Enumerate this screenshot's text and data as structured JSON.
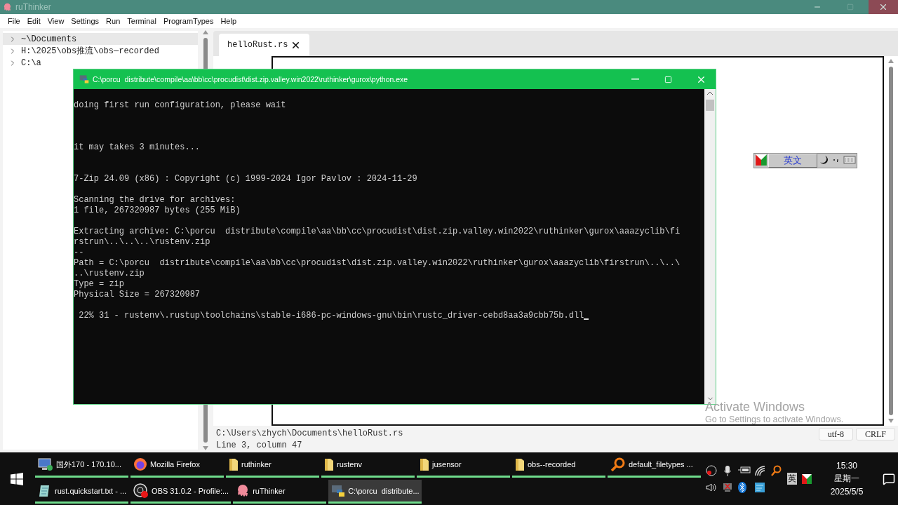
{
  "app": {
    "title": "ruThinker"
  },
  "menu": [
    "File",
    "Edit",
    "View",
    "Settings",
    "Run",
    "Terminal",
    "ProgramTypes",
    "Help"
  ],
  "tree": [
    {
      "label": "~\\Documents",
      "selected": true
    },
    {
      "label": "H:\\2025\\obs推流\\obs—recorded",
      "selected": false
    },
    {
      "label": "C:\\a",
      "selected": false
    }
  ],
  "tabs": [
    {
      "label": "helloRust.rs",
      "selected": true
    }
  ],
  "status": {
    "path": "C:\\Users\\zhych\\Documents\\helloRust.rs",
    "position": "Line 3, column 47",
    "encoding": "utf-8",
    "line_ending": "CRLF"
  },
  "console": {
    "title": "C:\\porcu  distribute\\compile\\aa\\bb\\cc\\procudist\\dist.zip.valley.win2022\\ruthinker\\gurox\\python.exe",
    "blocks": [
      [
        "doing first run configuration, please wait"
      ],
      [
        "it may takes 3 minutes..."
      ],
      [
        "7-Zip 24.09 (x86) : Copyright (c) 1999-2024 Igor Pavlov : 2024-11-29"
      ],
      [
        "Scanning the drive for archives:",
        "1 file, 267320987 bytes (255 MiB)"
      ],
      [
        "Extracting archive: C:\\porcu  distribute\\compile\\aa\\bb\\cc\\procudist\\dist.zip.valley.win2022\\ruthinker\\gurox\\aaazyclib\\fi",
        "rstrun\\..\\..\\..\\rustenv.zip",
        "--",
        "Path = C:\\porcu  distribute\\compile\\aa\\bb\\cc\\procudist\\dist.zip.valley.win2022\\ruthinker\\gurox\\aaazyclib\\firstrun\\..\\..\\",
        "..\\rustenv.zip",
        "Type = zip",
        "Physical Size = 267320987"
      ],
      [
        " 22% 31 - rustenv\\.rustup\\toolchains\\stable-i686-pc-windows-gnu\\bin\\rustc_driver-cebd8aa3a9cbb75b.dll"
      ]
    ]
  },
  "ime_toolbar": {
    "mode": "英文"
  },
  "activation": {
    "title": "Activate Windows",
    "subtitle": "Go to Settings to activate Windows."
  },
  "taskbar": {
    "rows": [
      [
        {
          "label": "国外170 - 170.10...",
          "kind": "remote",
          "selected": false
        },
        {
          "label": "Mozilla Firefox",
          "kind": "firefox",
          "selected": false
        },
        {
          "label": "ruthinker",
          "kind": "folder",
          "selected": false
        },
        {
          "label": "rustenv",
          "kind": "folder",
          "selected": false
        },
        {
          "label": "jusensor",
          "kind": "folder",
          "selected": false
        },
        {
          "label": "obs--recorded",
          "kind": "folder",
          "selected": false
        },
        {
          "label": "default_filetypes ...",
          "kind": "search",
          "selected": false
        }
      ],
      [
        {
          "label": "rust.quickstart.txt - ...",
          "kind": "notepad",
          "selected": false
        },
        {
          "label": "OBS 31.0.2 - Profile:...",
          "kind": "obs",
          "selected": false
        },
        {
          "label": "ruThinker",
          "kind": "octopus",
          "selected": false
        },
        {
          "label": "C:\\porcu  distribute...",
          "kind": "python",
          "selected": true
        }
      ]
    ]
  },
  "tray": {
    "ime": "英",
    "time": "15:30",
    "weekday": "星期一",
    "date": "2025/5/5"
  }
}
